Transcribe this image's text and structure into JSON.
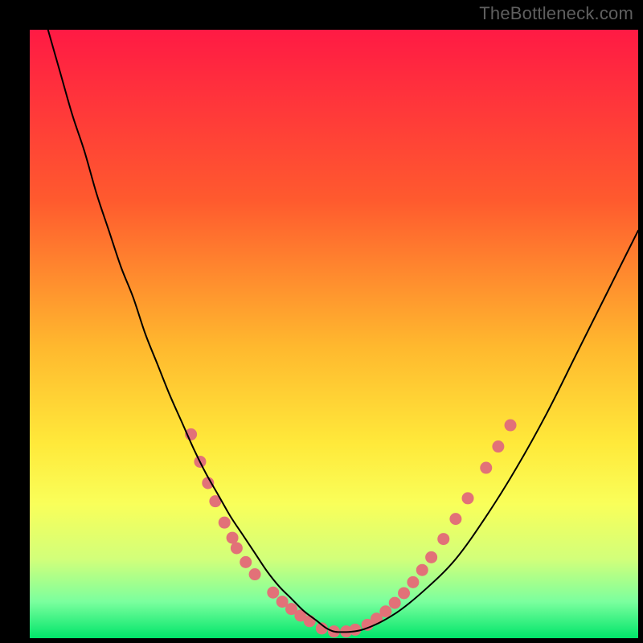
{
  "watermark": "TheBottleneck.com",
  "chart_data": {
    "type": "line",
    "title": "",
    "xlabel": "",
    "ylabel": "",
    "xlim": [
      0,
      100
    ],
    "ylim": [
      0,
      100
    ],
    "grid": false,
    "legend": false,
    "gradient_stops": [
      {
        "offset": 0.0,
        "color": "#ff1a44"
      },
      {
        "offset": 0.28,
        "color": "#ff5a2e"
      },
      {
        "offset": 0.52,
        "color": "#ffb82e"
      },
      {
        "offset": 0.68,
        "color": "#ffe93a"
      },
      {
        "offset": 0.78,
        "color": "#f9ff5a"
      },
      {
        "offset": 0.87,
        "color": "#d2ff7a"
      },
      {
        "offset": 0.94,
        "color": "#7bff9e"
      },
      {
        "offset": 1.0,
        "color": "#00e56a"
      }
    ],
    "series": [
      {
        "name": "curve",
        "stroke": "#000000",
        "stroke_width": 2,
        "x": [
          3,
          5,
          7,
          9,
          11,
          13,
          15,
          17,
          19,
          21,
          23,
          25,
          27,
          29,
          31,
          33,
          35,
          37,
          39,
          41,
          43,
          45,
          47,
          49,
          51,
          55,
          60,
          65,
          70,
          75,
          80,
          85,
          90,
          95,
          100
        ],
        "y": [
          100,
          93,
          86,
          80,
          73,
          67,
          61,
          56,
          50,
          45,
          40,
          35.5,
          31,
          27,
          23.5,
          20,
          17,
          14,
          11,
          8.5,
          6.5,
          4.5,
          3,
          1.5,
          1,
          1.5,
          4,
          8,
          13,
          20,
          28,
          37,
          47,
          57,
          67
        ]
      }
    ],
    "markers": {
      "color": "#e27178",
      "radius": 7.5,
      "points": [
        {
          "x": 26.5,
          "y": 33.5
        },
        {
          "x": 28.0,
          "y": 29.0
        },
        {
          "x": 29.3,
          "y": 25.5
        },
        {
          "x": 30.5,
          "y": 22.5
        },
        {
          "x": 32.0,
          "y": 19.0
        },
        {
          "x": 33.3,
          "y": 16.5
        },
        {
          "x": 34.0,
          "y": 14.8
        },
        {
          "x": 35.5,
          "y": 12.5
        },
        {
          "x": 37.0,
          "y": 10.5
        },
        {
          "x": 40.0,
          "y": 7.5
        },
        {
          "x": 41.5,
          "y": 6.0
        },
        {
          "x": 43.0,
          "y": 4.8
        },
        {
          "x": 44.5,
          "y": 3.7
        },
        {
          "x": 46.0,
          "y": 2.8
        },
        {
          "x": 48.0,
          "y": 1.6
        },
        {
          "x": 50.0,
          "y": 1.1
        },
        {
          "x": 52.0,
          "y": 1.1
        },
        {
          "x": 53.5,
          "y": 1.4
        },
        {
          "x": 55.5,
          "y": 2.2
        },
        {
          "x": 57.0,
          "y": 3.2
        },
        {
          "x": 58.5,
          "y": 4.4
        },
        {
          "x": 60.0,
          "y": 5.8
        },
        {
          "x": 61.5,
          "y": 7.4
        },
        {
          "x": 63.0,
          "y": 9.2
        },
        {
          "x": 64.5,
          "y": 11.2
        },
        {
          "x": 66.0,
          "y": 13.3
        },
        {
          "x": 68.0,
          "y": 16.3
        },
        {
          "x": 70.0,
          "y": 19.6
        },
        {
          "x": 72.0,
          "y": 23.0
        },
        {
          "x": 75.0,
          "y": 28.0
        },
        {
          "x": 77.0,
          "y": 31.5
        },
        {
          "x": 79.0,
          "y": 35.0
        }
      ]
    }
  }
}
